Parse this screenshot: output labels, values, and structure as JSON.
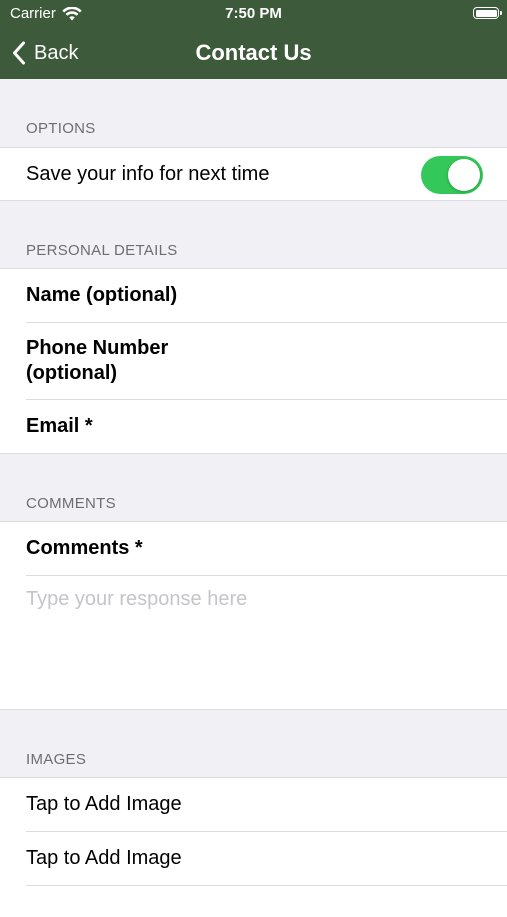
{
  "status_bar": {
    "carrier": "Carrier",
    "time": "7:50 PM"
  },
  "nav": {
    "back_label": "Back",
    "title": "Contact Us"
  },
  "options": {
    "header": "OPTIONS",
    "save_info_label": "Save your info for next time",
    "save_info_enabled": true
  },
  "personal": {
    "header": "PERSONAL DETAILS",
    "name_label": "Name (optional)",
    "phone_label_line1": "Phone Number",
    "phone_label_line2": "(optional)",
    "email_label": "Email *"
  },
  "comments": {
    "header": "COMMENTS",
    "label": "Comments *",
    "placeholder": "Type your response here",
    "value": ""
  },
  "images": {
    "header": "IMAGES",
    "items": [
      "Tap to Add Image",
      "Tap to Add Image"
    ]
  },
  "colors": {
    "nav_bg": "#3d5a3a",
    "toggle_on": "#34c759",
    "page_bg": "#f1f1f5"
  }
}
